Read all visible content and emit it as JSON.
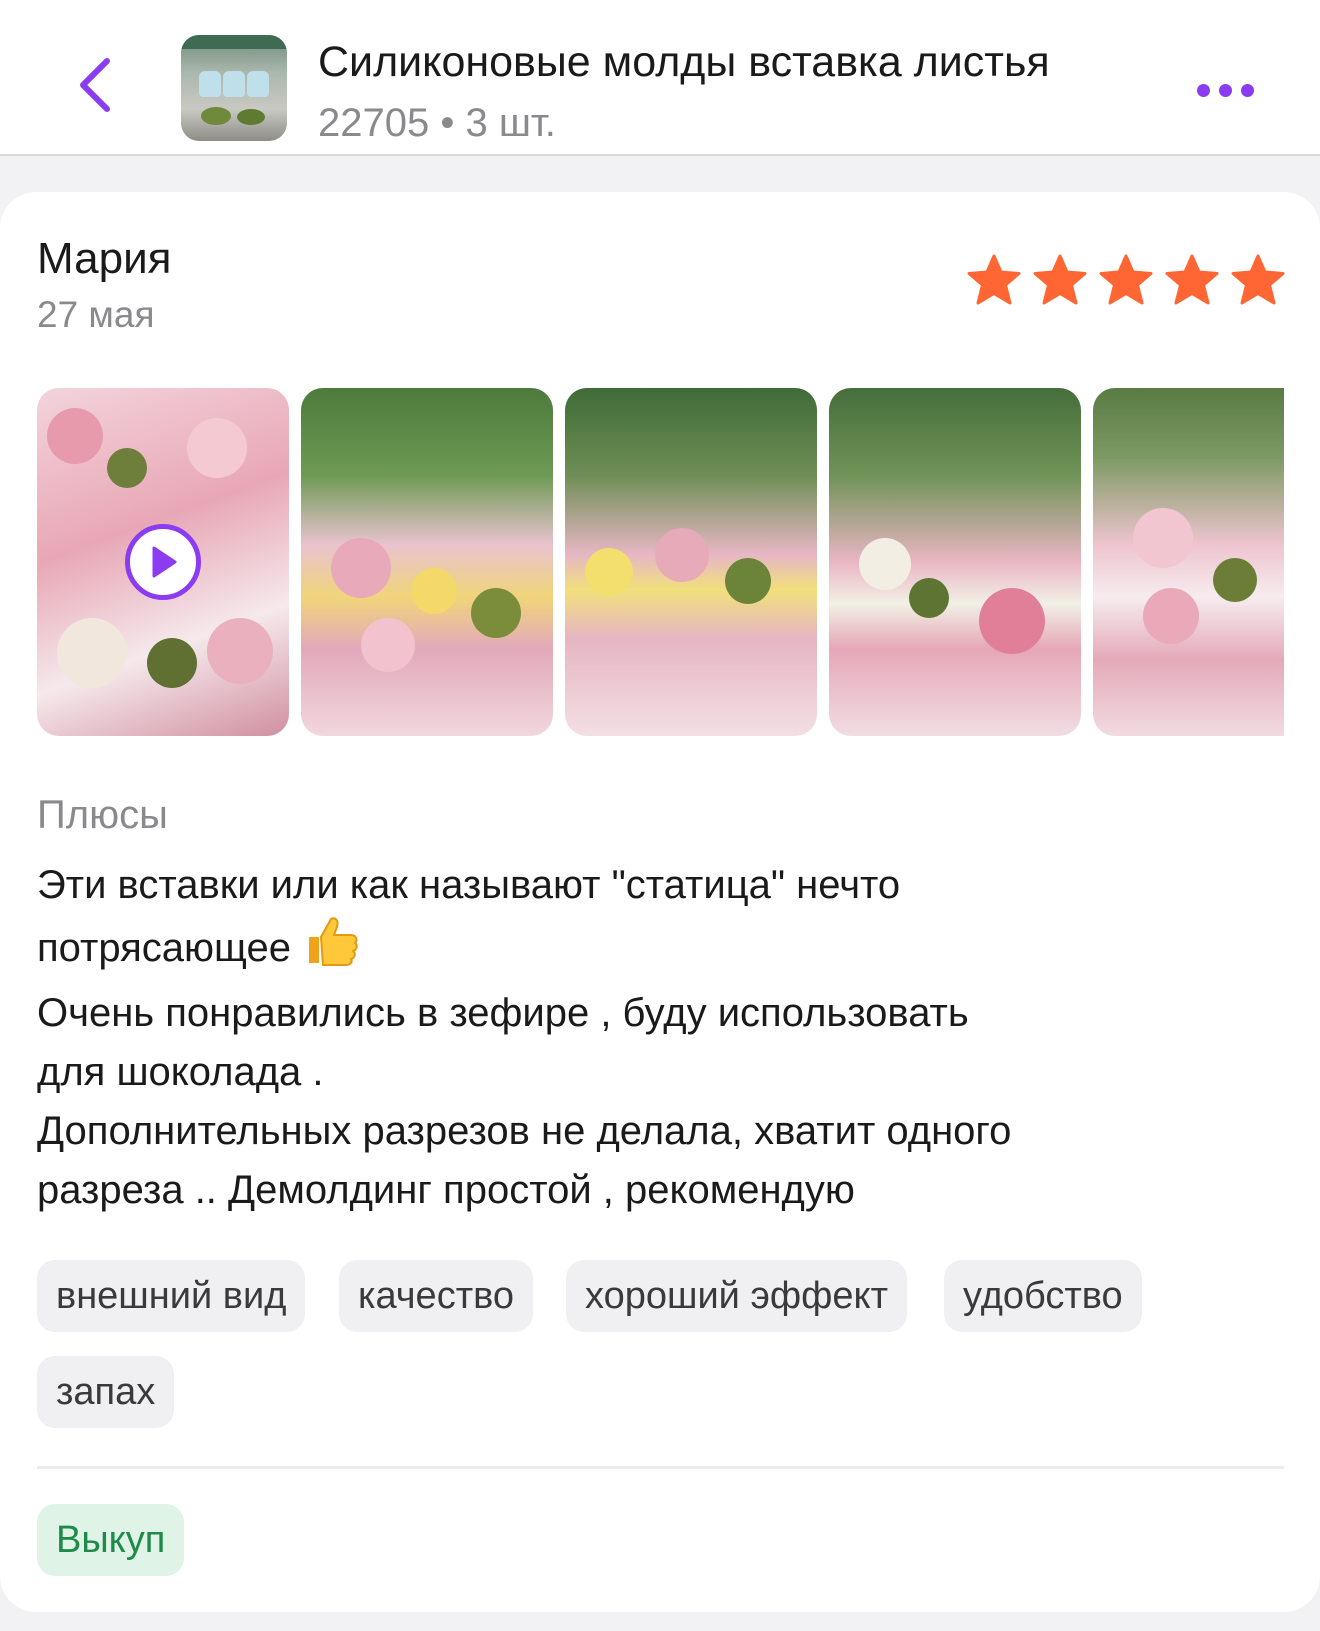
{
  "header": {
    "back_icon": "chevron-left-icon",
    "title": "Силиконовые молды вставка листья",
    "subtitle": "22705 • 3 шт.",
    "more_icon": "more-dots-icon",
    "accent": "#8b3cf0"
  },
  "review": {
    "author": "Мария",
    "date": "27 мая",
    "rating": 5,
    "rating_max": 5,
    "star_color": "#ff6633",
    "media": [
      {
        "kind": "video",
        "icon": "play-icon"
      },
      {
        "kind": "photo"
      },
      {
        "kind": "photo"
      },
      {
        "kind": "photo"
      },
      {
        "kind": "photo"
      }
    ],
    "pros_label": "Плюсы",
    "text_lines": [
      "Эти вставки или как называют \"статица\" нечто",
      "потрясающее",
      "Очень понравились в зефире , буду использовать",
      "для шоколада .",
      "Дополнительных разрезов не делала, хватит одного",
      "разреза .. Демолдинг простой , рекомендую"
    ],
    "emoji": "thumbs-up-icon",
    "tags": [
      "внешний вид",
      "качество",
      "хороший эффект",
      "удобство",
      "запах"
    ],
    "badge": "Выкуп",
    "badge_color": "#1f8a4a"
  }
}
